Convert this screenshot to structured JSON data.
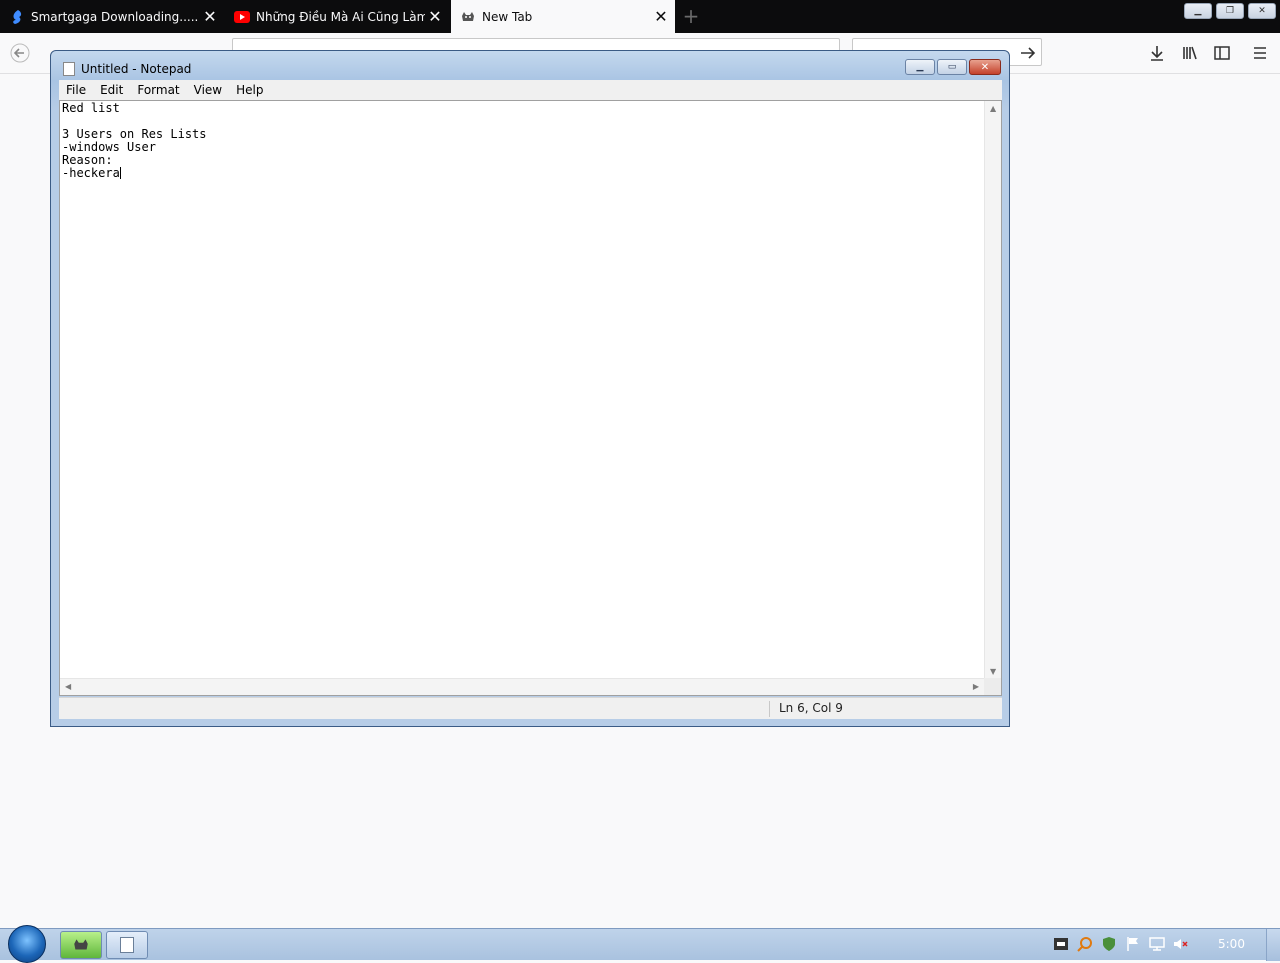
{
  "browser": {
    "tabs": [
      {
        "title": "Smartgaga Downloading..... | S",
        "icon": "smartgaga-icon",
        "active": false
      },
      {
        "title": "Những Điều Mà Ai Cũng Làm |",
        "icon": "youtube-icon",
        "active": false
      },
      {
        "title": "New Tab",
        "icon": "cat-icon",
        "active": true
      }
    ],
    "new_tab_label": "+"
  },
  "notepad": {
    "title": "Untitled - Notepad",
    "menu": [
      "File",
      "Edit",
      "Format",
      "View",
      "Help"
    ],
    "content": "Red list\n\n3 Users on Res Lists\n-windows User\nReason:\n-heckera",
    "status": "Ln 6, Col 9"
  },
  "taskbar": {
    "clock": "5:00"
  },
  "colors": {
    "tab_strip": "#0c0c0d",
    "active_tab": "#f9f9fa",
    "youtube_red": "#ff0000",
    "notepad_frame": "#a9c4e3",
    "close_red": "#c4412b"
  }
}
